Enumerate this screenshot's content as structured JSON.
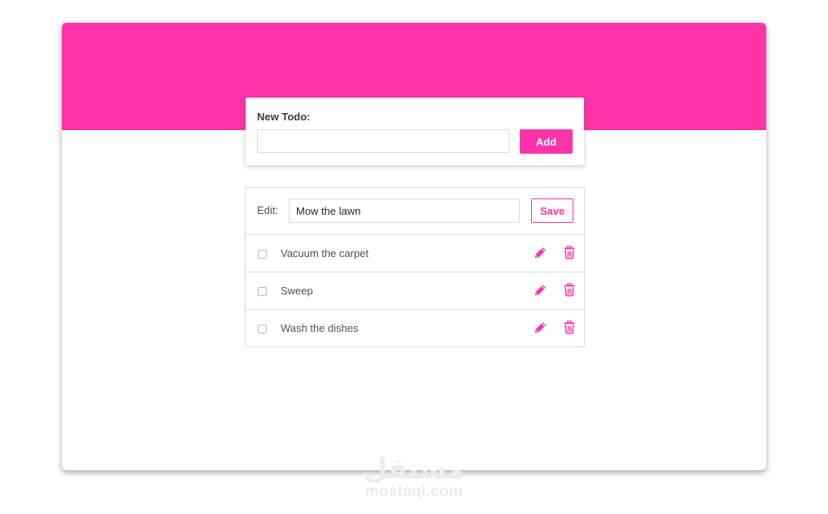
{
  "new_todo": {
    "label": "New Todo:",
    "input_value": "",
    "add_label": "Add"
  },
  "edit": {
    "label": "Edit:",
    "input_value": "Mow the lawn",
    "save_label": "Save"
  },
  "todos": [
    {
      "text": "Vacuum the carpet",
      "checked": false
    },
    {
      "text": "Sweep",
      "checked": false
    },
    {
      "text": "Wash the dishes",
      "checked": false
    }
  ],
  "icons": {
    "edit": "pencil-icon",
    "delete": "trash-icon"
  },
  "watermark": {
    "logo_text": "مستقل",
    "domain": "mostaql.com"
  },
  "colors": {
    "accent": "#ff33a9",
    "text": "#4a4f5c",
    "border": "#d9dbe0"
  }
}
